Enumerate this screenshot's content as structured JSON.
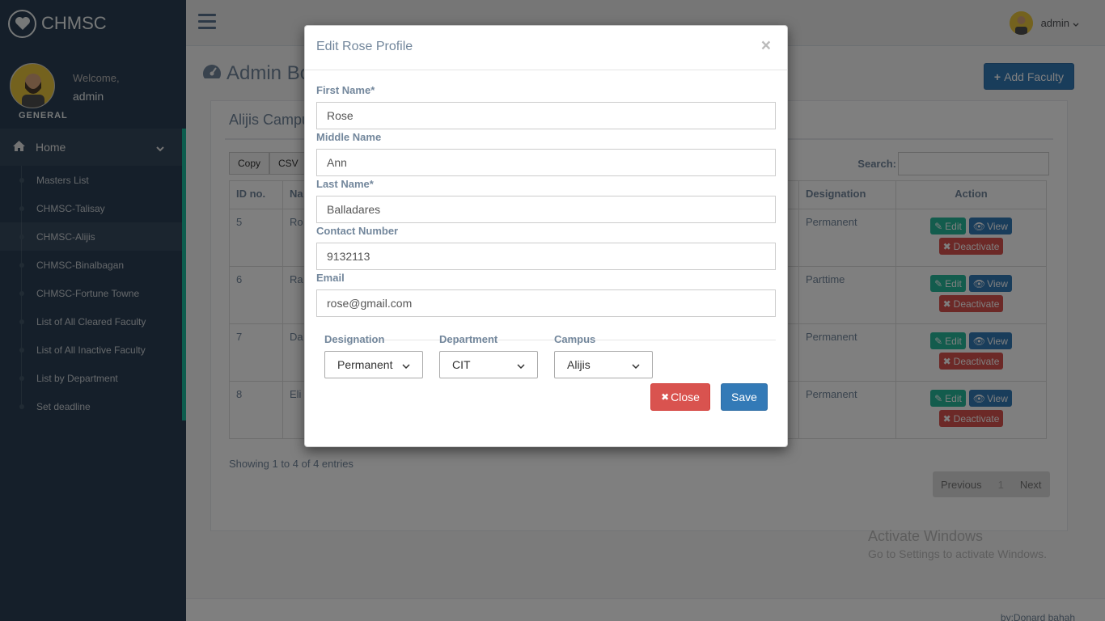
{
  "brand": {
    "name": "CHMSC"
  },
  "profile": {
    "welcome": "Welcome,",
    "name": "admin",
    "role": "GENERAL"
  },
  "sidebar": {
    "home_label": "Home",
    "items": [
      {
        "label": "Masters List"
      },
      {
        "label": "CHMSC-Talisay"
      },
      {
        "label": "CHMSC-Alijis"
      },
      {
        "label": "CHMSC-Binalbagan"
      },
      {
        "label": "CHMSC-Fortune Towne"
      },
      {
        "label": "List of All Cleared Faculty"
      },
      {
        "label": "List of All Inactive Faculty"
      },
      {
        "label": "List by Department"
      },
      {
        "label": "Set deadline"
      }
    ]
  },
  "topbar": {
    "user": "admin"
  },
  "main": {
    "title": "Admin Bo",
    "add_button": "Add Faculty",
    "panel_title": "Alijis Campu",
    "export": [
      "Copy",
      "CSV"
    ],
    "search_label": "Search:",
    "columns": [
      "ID no.",
      "Na",
      "Designation",
      "Action"
    ],
    "rows": [
      {
        "id": "5",
        "name": "Ro",
        "designation": "Permanent"
      },
      {
        "id": "6",
        "name": "Ra",
        "designation": "Parttime"
      },
      {
        "id": "7",
        "name": "Da",
        "designation": "Permanent"
      },
      {
        "id": "8",
        "name": "Eli",
        "designation": "Permanent"
      }
    ],
    "actions": {
      "edit": "Edit",
      "view": "View",
      "deactivate": "Deactivate"
    },
    "entries": "Showing 1 to 4 of 4 entries",
    "pager": {
      "prev": "Previous",
      "page": "1",
      "next": "Next"
    },
    "watermark_title": "Activate Windows",
    "watermark_sub": "Go to Settings to activate Windows.",
    "footer": "by:Donard bahah"
  },
  "modal": {
    "title": "Edit Rose Profile",
    "close_x": "×",
    "first_name_label": "First Name*",
    "first_name": "Rose",
    "middle_name_label": "Middle Name",
    "middle_name": "Ann",
    "last_name_label": "Last Name*",
    "last_name": "Balladares",
    "contact_label": "Contact Number",
    "contact": "9132113",
    "email_label": "Email",
    "email": "rose@gmail.com",
    "designation_label": "Designation",
    "designation": "Permanent",
    "department_label": "Department",
    "department": "CIT",
    "campus_label": "Campus",
    "campus": "Alijis",
    "close_button": "Close",
    "save_button": "Save"
  }
}
